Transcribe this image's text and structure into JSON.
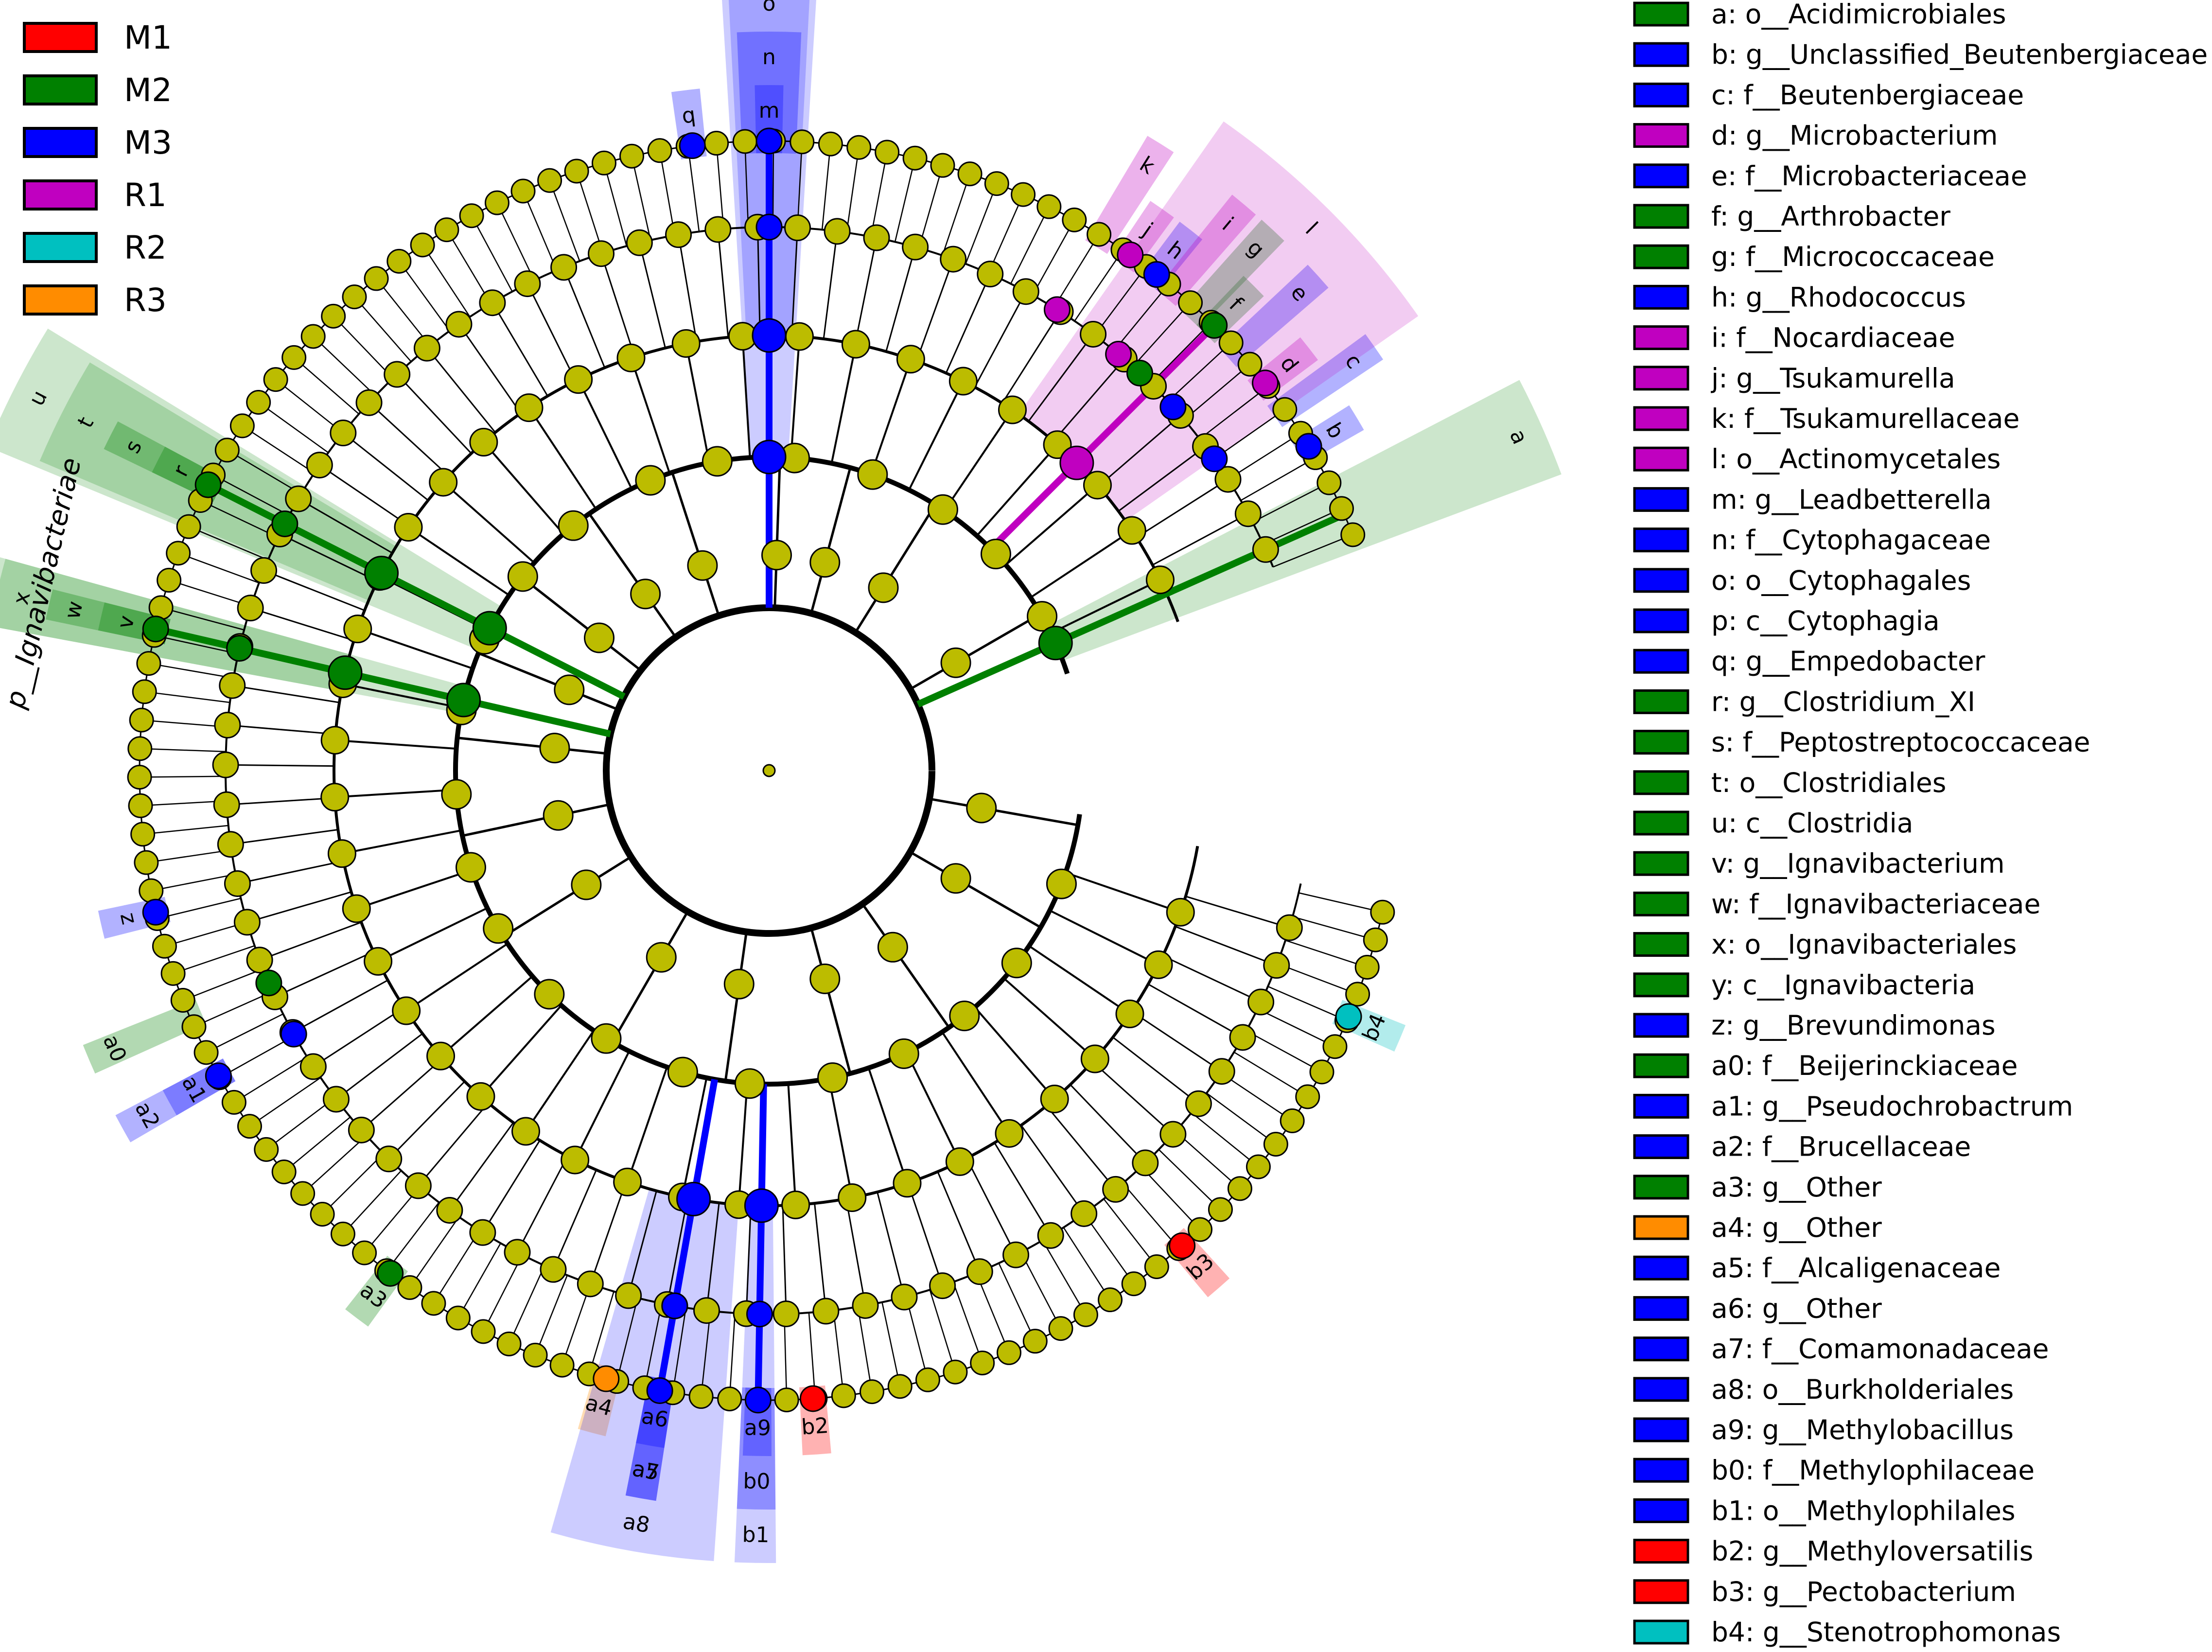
{
  "group_legend": [
    {
      "name": "M1",
      "color": "#ff0000"
    },
    {
      "name": "M2",
      "color": "#008000"
    },
    {
      "name": "M3",
      "color": "#0000ff"
    },
    {
      "name": "R1",
      "color": "#c000c0"
    },
    {
      "name": "R2",
      "color": "#00c0c0"
    },
    {
      "name": "R3",
      "color": "#ff8c00"
    }
  ],
  "taxa_legend": [
    {
      "key": "a",
      "text": "a: o__Acidimicrobiales",
      "group": "M2"
    },
    {
      "key": "b",
      "text": "b: g__Unclassified_Beutenbergiaceae",
      "group": "M3"
    },
    {
      "key": "c",
      "text": "c: f__Beutenbergiaceae",
      "group": "M3"
    },
    {
      "key": "d",
      "text": "d: g__Microbacterium",
      "group": "R1"
    },
    {
      "key": "e",
      "text": "e: f__Microbacteriaceae",
      "group": "M3"
    },
    {
      "key": "f",
      "text": "f: g__Arthrobacter",
      "group": "M2"
    },
    {
      "key": "g",
      "text": "g: f__Micrococcaceae",
      "group": "M2"
    },
    {
      "key": "h",
      "text": "h: g__Rhodococcus",
      "group": "M3"
    },
    {
      "key": "i",
      "text": "i: f__Nocardiaceae",
      "group": "R1"
    },
    {
      "key": "j",
      "text": "j: g__Tsukamurella",
      "group": "R1"
    },
    {
      "key": "k",
      "text": "k: f__Tsukamurellaceae",
      "group": "R1"
    },
    {
      "key": "l",
      "text": "l: o__Actinomycetales",
      "group": "R1"
    },
    {
      "key": "m",
      "text": "m: g__Leadbetterella",
      "group": "M3"
    },
    {
      "key": "n",
      "text": "n: f__Cytophagaceae",
      "group": "M3"
    },
    {
      "key": "o",
      "text": "o: o__Cytophagales",
      "group": "M3"
    },
    {
      "key": "p",
      "text": "p: c__Cytophagia",
      "group": "M3"
    },
    {
      "key": "q",
      "text": "q: g__Empedobacter",
      "group": "M3"
    },
    {
      "key": "r",
      "text": "r: g__Clostridium_XI",
      "group": "M2"
    },
    {
      "key": "s",
      "text": "s: f__Peptostreptococcaceae",
      "group": "M2"
    },
    {
      "key": "t",
      "text": "t: o__Clostridiales",
      "group": "M2"
    },
    {
      "key": "u",
      "text": "u: c__Clostridia",
      "group": "M2"
    },
    {
      "key": "v",
      "text": "v: g__Ignavibacterium",
      "group": "M2"
    },
    {
      "key": "w",
      "text": "w: f__Ignavibacteriaceae",
      "group": "M2"
    },
    {
      "key": "x",
      "text": "x: o__Ignavibacteriales",
      "group": "M2"
    },
    {
      "key": "y",
      "text": "y: c__Ignavibacteria",
      "group": "M2"
    },
    {
      "key": "z",
      "text": "z: g__Brevundimonas",
      "group": "M3"
    },
    {
      "key": "a0",
      "text": "a0: f__Beijerinckiaceae",
      "group": "M2"
    },
    {
      "key": "a1",
      "text": "a1: g__Pseudochrobactrum",
      "group": "M3"
    },
    {
      "key": "a2",
      "text": "a2: f__Brucellaceae",
      "group": "M3"
    },
    {
      "key": "a3",
      "text": "a3: g__Other",
      "group": "M2"
    },
    {
      "key": "a4",
      "text": "a4: g__Other",
      "group": "R3"
    },
    {
      "key": "a5",
      "text": "a5: f__Alcaligenaceae",
      "group": "M3"
    },
    {
      "key": "a6",
      "text": "a6: g__Other",
      "group": "M3"
    },
    {
      "key": "a7",
      "text": "a7: f__Comamonadaceae",
      "group": "M3"
    },
    {
      "key": "a8",
      "text": "a8: o__Burkholderiales",
      "group": "M3"
    },
    {
      "key": "a9",
      "text": "a9: g__Methylobacillus",
      "group": "M3"
    },
    {
      "key": "b0",
      "text": "b0: f__Methylophilaceae",
      "group": "M3"
    },
    {
      "key": "b1",
      "text": "b1: o__Methylophilales",
      "group": "M3"
    },
    {
      "key": "b2",
      "text": "b2: g__Methyloversatilis",
      "group": "M1"
    },
    {
      "key": "b3",
      "text": "b3: g__Pectobacterium",
      "group": "M1"
    },
    {
      "key": "b4",
      "text": "b4: g__Stenotrophomonas",
      "group": "R2"
    }
  ],
  "cladogram": {
    "node_color": "#bcbc00",
    "phylum_label": "p__Ignavibacteriae",
    "levels": [
      "phylum",
      "class",
      "order",
      "family",
      "genus"
    ],
    "highlighted_clades": [
      {
        "key": "a",
        "group": "M2",
        "angle_deg": 24
      },
      {
        "key": "b",
        "group": "M3",
        "angle_deg": 31
      },
      {
        "key": "c",
        "group": "M3",
        "angle_deg": 35
      },
      {
        "key": "d",
        "group": "R1",
        "angle_deg": 38
      },
      {
        "key": "e",
        "group": "M3",
        "angle_deg": 42
      },
      {
        "key": "f",
        "group": "M2",
        "angle_deg": 45
      },
      {
        "key": "g",
        "group": "M2",
        "angle_deg": 47
      },
      {
        "key": "h",
        "group": "M3",
        "angle_deg": 52
      },
      {
        "key": "i",
        "group": "R1",
        "angle_deg": 50
      },
      {
        "key": "j",
        "group": "R1",
        "angle_deg": 55
      },
      {
        "key": "k",
        "group": "R1",
        "angle_deg": 58
      },
      {
        "key": "l",
        "group": "R1",
        "angle_deg": 45
      },
      {
        "key": "m",
        "group": "M3",
        "angle_deg": 90
      },
      {
        "key": "n",
        "group": "M3",
        "angle_deg": 90
      },
      {
        "key": "o",
        "group": "M3",
        "angle_deg": 90
      },
      {
        "key": "p",
        "group": "M3",
        "angle_deg": 90
      },
      {
        "key": "q",
        "group": "M3",
        "angle_deg": 97
      },
      {
        "key": "r",
        "group": "M2",
        "angle_deg": 153
      },
      {
        "key": "s",
        "group": "M2",
        "angle_deg": 153
      },
      {
        "key": "t",
        "group": "M2",
        "angle_deg": 153
      },
      {
        "key": "u",
        "group": "M2",
        "angle_deg": 153
      },
      {
        "key": "v",
        "group": "M2",
        "angle_deg": 167
      },
      {
        "key": "w",
        "group": "M2",
        "angle_deg": 167
      },
      {
        "key": "x",
        "group": "M2",
        "angle_deg": 167
      },
      {
        "key": "y",
        "group": "M2",
        "angle_deg": 167
      },
      {
        "key": "z",
        "group": "M3",
        "angle_deg": 193
      },
      {
        "key": "a0",
        "group": "M2",
        "angle_deg": 203
      },
      {
        "key": "a1",
        "group": "M3",
        "angle_deg": 209
      },
      {
        "key": "a2",
        "group": "M3",
        "angle_deg": 209
      },
      {
        "key": "a3",
        "group": "M2",
        "angle_deg": 233
      },
      {
        "key": "a4",
        "group": "R3",
        "angle_deg": 255
      },
      {
        "key": "a5",
        "group": "M3",
        "angle_deg": 260
      },
      {
        "key": "a6",
        "group": "M3",
        "angle_deg": 260
      },
      {
        "key": "a7",
        "group": "M3",
        "angle_deg": 260
      },
      {
        "key": "a8",
        "group": "M3",
        "angle_deg": 260
      },
      {
        "key": "a9",
        "group": "M3",
        "angle_deg": 269
      },
      {
        "key": "b0",
        "group": "M3",
        "angle_deg": 269
      },
      {
        "key": "b1",
        "group": "M3",
        "angle_deg": 269
      },
      {
        "key": "b2",
        "group": "M1",
        "angle_deg": 274
      },
      {
        "key": "b3",
        "group": "M1",
        "angle_deg": 311
      },
      {
        "key": "b4",
        "group": "R2",
        "angle_deg": 337
      }
    ]
  }
}
